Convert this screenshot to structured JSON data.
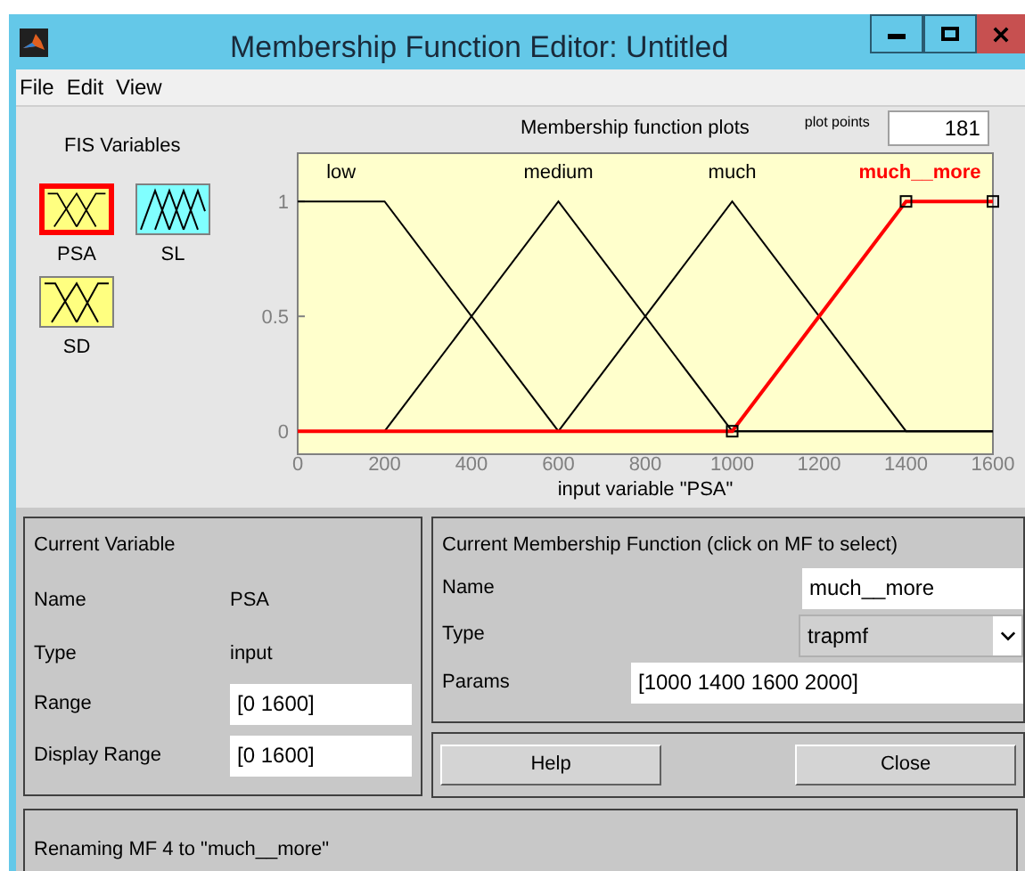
{
  "window": {
    "title": "Membership Function Editor: Untitled"
  },
  "menu": [
    "File",
    "Edit",
    "View"
  ],
  "fis_variables": {
    "heading": "FIS Variables",
    "items": [
      {
        "label": "PSA",
        "kind": "input",
        "selected": true
      },
      {
        "label": "SL",
        "kind": "output",
        "selected": false
      },
      {
        "label": "SD",
        "kind": "input",
        "selected": false
      }
    ]
  },
  "plot": {
    "title": "Membership function plots",
    "plot_points_label": "plot points",
    "plot_points": "181",
    "curves": [
      {
        "selected": false
      },
      {
        "selected": false
      },
      {
        "selected": false
      },
      {
        "selected": true
      }
    ],
    "chart_data": {
      "type": "line",
      "xlabel": "input variable \"PSA\"",
      "x": [
        0,
        200,
        400,
        600,
        800,
        1000,
        1200,
        1400,
        1600
      ],
      "xlim": [
        0,
        1600
      ],
      "ylim": [
        -0.1,
        1.21
      ],
      "xticks": [
        0,
        200,
        400,
        600,
        800,
        1000,
        1200,
        1400,
        1600
      ],
      "yticks": [
        0,
        0.5,
        1
      ],
      "series": [
        {
          "name": "low",
          "color": "#000000",
          "values": [
            1,
            1,
            0.5,
            0,
            0,
            0,
            0,
            0,
            0
          ]
        },
        {
          "name": "medium",
          "color": "#000000",
          "values": [
            0,
            0,
            0.5,
            1,
            0.5,
            0,
            0,
            0,
            0
          ]
        },
        {
          "name": "much",
          "color": "#000000",
          "values": [
            0,
            0,
            0,
            0,
            0.5,
            1,
            0.5,
            0,
            0
          ]
        },
        {
          "name": "much__more",
          "color": "#ff0000",
          "values": [
            0,
            0,
            0,
            0,
            0,
            0,
            0.5,
            1,
            1
          ]
        }
      ]
    }
  },
  "current_variable": {
    "title": "Current Variable",
    "name_label": "Name",
    "name": "PSA",
    "type_label": "Type",
    "type": "input",
    "range_label": "Range",
    "range": "[0 1600]",
    "display_range_label": "Display Range",
    "display_range": "[0 1600]"
  },
  "current_mf": {
    "title": "Current Membership Function (click on MF to select)",
    "name_label": "Name",
    "name": "much__more",
    "type_label": "Type",
    "type": "trapmf",
    "params_label": "Params",
    "params": "[1000 1400 1600 2000]"
  },
  "buttons": [
    "Help",
    "Close"
  ],
  "status": "Renaming MF 4 to \"much__more\""
}
